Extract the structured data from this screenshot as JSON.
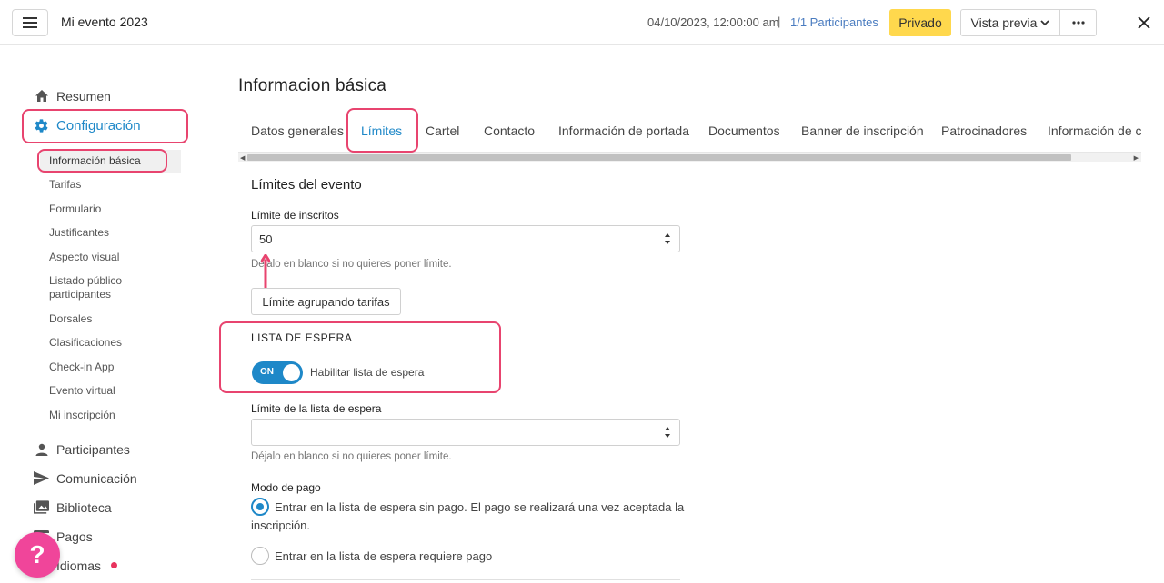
{
  "topbar": {
    "event_title": "Mi evento 2023",
    "datetime": "04/10/2023, 12:00:00 am",
    "separator": "|",
    "participants": "1/1 Participantes",
    "privado": "Privado",
    "preview": "Vista previa"
  },
  "sidebar": {
    "main_top": [
      {
        "label": "Resumen",
        "icon": "home-icon"
      },
      {
        "label": "Configuración",
        "icon": "gear-icon",
        "active": true
      }
    ],
    "sub_items": [
      {
        "label": "Información básica",
        "active": true
      },
      {
        "label": "Tarifas"
      },
      {
        "label": "Formulario"
      },
      {
        "label": "Justificantes"
      },
      {
        "label": "Aspecto visual"
      },
      {
        "label": "Listado público participantes"
      },
      {
        "label": "Dorsales"
      },
      {
        "label": "Clasificaciones"
      },
      {
        "label": "Check-in App"
      },
      {
        "label": "Evento virtual"
      },
      {
        "label": "Mi inscripción"
      }
    ],
    "main_bottom": [
      {
        "label": "Participantes",
        "icon": "person-icon"
      },
      {
        "label": "Comunicación",
        "icon": "send-icon"
      },
      {
        "label": "Biblioteca",
        "icon": "images-icon"
      },
      {
        "label": "Pagos",
        "icon": "payments-icon"
      },
      {
        "label": "Idiomas",
        "icon": "language-icon"
      }
    ]
  },
  "main": {
    "page_title": "Informacion básica",
    "tabs": [
      {
        "label": "Datos generales"
      },
      {
        "label": "Límites",
        "active": true
      },
      {
        "label": "Cartel"
      },
      {
        "label": "Contacto"
      },
      {
        "label": "Información de portada"
      },
      {
        "label": "Documentos"
      },
      {
        "label": "Banner de inscripción"
      },
      {
        "label": "Patrocinadores"
      },
      {
        "label": "Información de ca"
      }
    ],
    "section_title": "Límites del evento",
    "limit_label": "Límite de inscritos",
    "limit_value": "50",
    "limit_help": "Déjalo en blanco si no quieres poner límite.",
    "group_button": "Límite agrupando tarifas",
    "waitlist_heading": "LISTA DE ESPERA",
    "toggle_state": "ON",
    "toggle_label": "Habilitar lista de espera",
    "waitlist_limit_label": "Límite de la lista de espera",
    "waitlist_limit_value": "",
    "waitlist_help": "Déjalo en blanco si no quieres poner límite.",
    "payment_mode_label": "Modo de pago",
    "payment_option_1": "Entrar en la lista de espera sin pago. El pago se realizará una vez aceptada la inscripción.",
    "payment_option_2": "Entrar en la lista de espera requiere pago"
  },
  "help_fab": "?",
  "colors": {
    "accent": "#1e88c8",
    "highlight": "#e8446f",
    "privado_bg": "#ffd84d",
    "fab": "#f0459a",
    "notification_dot": "#e8335e"
  }
}
